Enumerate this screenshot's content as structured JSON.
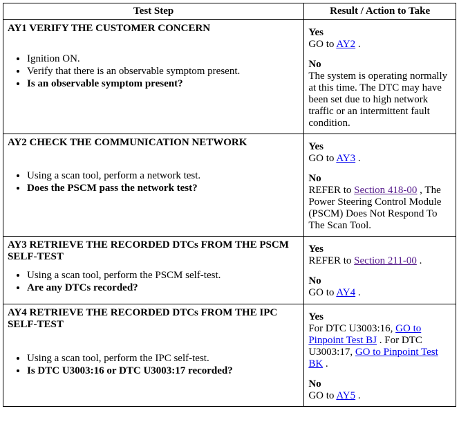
{
  "headers": {
    "testStep": "Test Step",
    "result": "Result / Action to Take"
  },
  "rows": [
    {
      "id": "AY1",
      "title": "AY1 VERIFY THE CUSTOMER CONCERN",
      "steps": [
        {
          "text": "Ignition ON.",
          "bold": false
        },
        {
          "text": "Verify that there is an observable symptom present.",
          "bold": false
        },
        {
          "text": "Is an observable symptom present?",
          "bold": true
        }
      ],
      "yesParts": [
        {
          "text": "GO to "
        },
        {
          "link": "AY2",
          "visited": false
        },
        {
          "text": " ."
        }
      ],
      "noParts": [
        {
          "text": "The system is operating normally at this time. The DTC may have been set due to high network traffic or an intermittent fault condition."
        }
      ]
    },
    {
      "id": "AY2",
      "title": "AY2 CHECK THE COMMUNICATION NETWORK",
      "steps": [
        {
          "text": "Using a scan tool, perform a network test.",
          "bold": false
        },
        {
          "text": "Does the PSCM pass the network test?",
          "bold": true
        }
      ],
      "yesParts": [
        {
          "text": "GO to "
        },
        {
          "link": "AY3",
          "visited": false
        },
        {
          "text": " ."
        }
      ],
      "noParts": [
        {
          "text": "REFER to "
        },
        {
          "link": "Section 418-00",
          "visited": true
        },
        {
          "text": " , The Power Steering Control Module (PSCM) Does Not Respond To The Scan Tool."
        }
      ]
    },
    {
      "id": "AY3",
      "title": "AY3 RETRIEVE THE RECORDED DTCs FROM THE PSCM SELF-TEST",
      "steps": [
        {
          "text": "Using a scan tool, perform the PSCM self-test.",
          "bold": false
        },
        {
          "text": "Are any DTCs recorded?",
          "bold": true
        }
      ],
      "yesParts": [
        {
          "text": "REFER to "
        },
        {
          "link": "Section 211-00",
          "visited": true
        },
        {
          "text": " ."
        }
      ],
      "noParts": [
        {
          "text": "GO to "
        },
        {
          "link": "AY4",
          "visited": false
        },
        {
          "text": " ."
        }
      ]
    },
    {
      "id": "AY4",
      "title": "AY4 RETRIEVE THE RECORDED DTCs FROM THE IPC SELF-TEST",
      "steps": [
        {
          "text": "Using a scan tool, perform the IPC self-test.",
          "bold": false
        },
        {
          "text": "Is DTC U3003:16 or DTC U3003:17 recorded?",
          "bold": true
        }
      ],
      "yesParts": [
        {
          "text": "For DTC U3003:16, "
        },
        {
          "link": "GO to Pinpoint Test BJ",
          "visited": false
        },
        {
          "text": " . For DTC U3003:17, "
        },
        {
          "link": "GO to Pinpoint Test BK",
          "visited": false
        },
        {
          "text": " ."
        }
      ],
      "noParts": [
        {
          "text": "GO to "
        },
        {
          "link": "AY5",
          "visited": false
        },
        {
          "text": " ."
        }
      ]
    }
  ],
  "labels": {
    "yes": "Yes",
    "no": "No"
  }
}
